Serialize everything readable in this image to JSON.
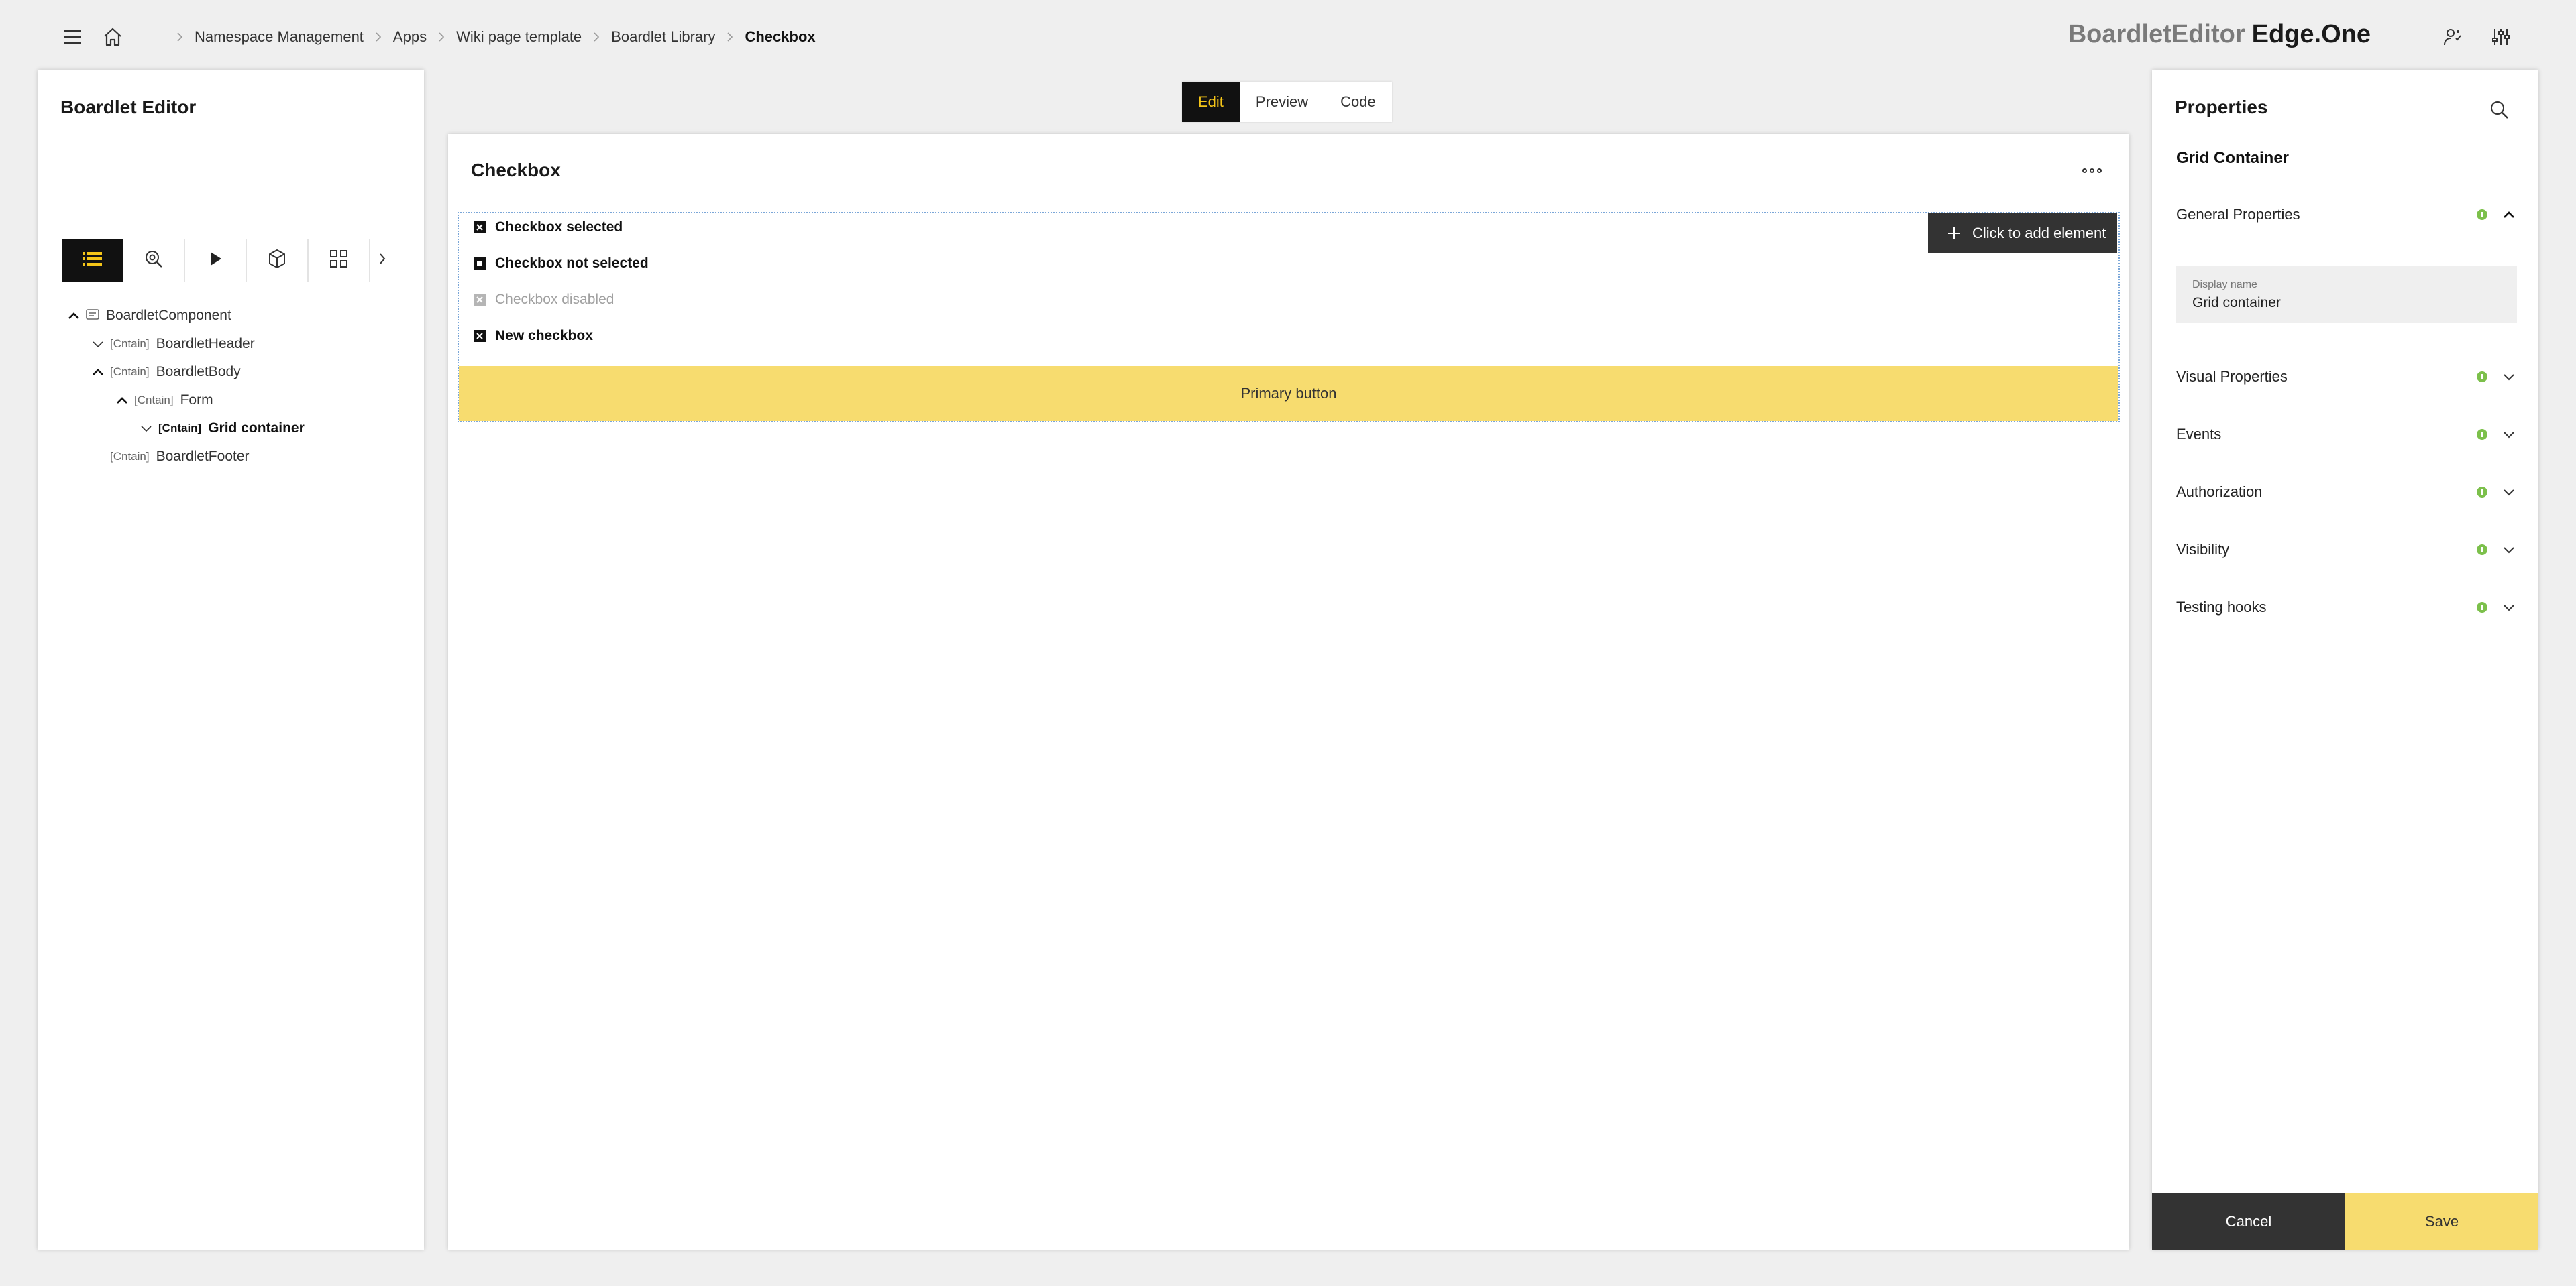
{
  "breadcrumb": {
    "items": [
      "Namespace Management",
      "Apps",
      "Wiki page template",
      "Boardlet Library"
    ],
    "current": "Checkbox"
  },
  "brand": {
    "part1": "BoardletEditor",
    "part2": "Edge.One"
  },
  "left_panel": {
    "title": "Boardlet Editor",
    "tools": [
      "list-icon",
      "inspect-icon",
      "play-icon",
      "cube-icon",
      "grid-icon",
      "chevron-right-icon"
    ],
    "tree": [
      {
        "tag": "",
        "label": "BoardletComponent",
        "toggle": "expanded"
      },
      {
        "tag": "[Cntain]",
        "label": "BoardletHeader",
        "toggle": "collapsed"
      },
      {
        "tag": "[Cntain]",
        "label": "BoardletBody",
        "toggle": "expanded"
      },
      {
        "tag": "[Cntain]",
        "label": "Form",
        "toggle": "expanded"
      },
      {
        "tag": "[Cntain]",
        "label": "Grid container",
        "toggle": "collapsed",
        "selected": true
      },
      {
        "tag": "[Cntain]",
        "label": "BoardletFooter",
        "toggle": "none"
      }
    ]
  },
  "view_tabs": {
    "edit": "Edit",
    "preview": "Preview",
    "code": "Code",
    "active": "Edit"
  },
  "canvas": {
    "title": "Checkbox",
    "checkboxes": [
      {
        "label": "Checkbox selected",
        "disabled": false
      },
      {
        "label": "Checkbox not selected",
        "disabled": false
      },
      {
        "label": "Checkbox disabled",
        "disabled": true
      },
      {
        "label": "New checkbox",
        "disabled": false
      }
    ],
    "add_element": "Click to add element",
    "primary_button": "Primary button"
  },
  "right_panel": {
    "title": "Properties",
    "subtitle": "Grid Container",
    "sections": [
      "General Properties",
      "Visual Properties",
      "Events",
      "Authorization",
      "Visibility",
      "Testing hooks"
    ],
    "display_name_label": "Display name",
    "display_name_value": "Grid container",
    "cancel": "Cancel",
    "save": "Save"
  },
  "colors": {
    "accent": "#f5c518",
    "primary_fill": "#f7dc6f",
    "dark": "#111111",
    "info": "#7cc04b"
  }
}
